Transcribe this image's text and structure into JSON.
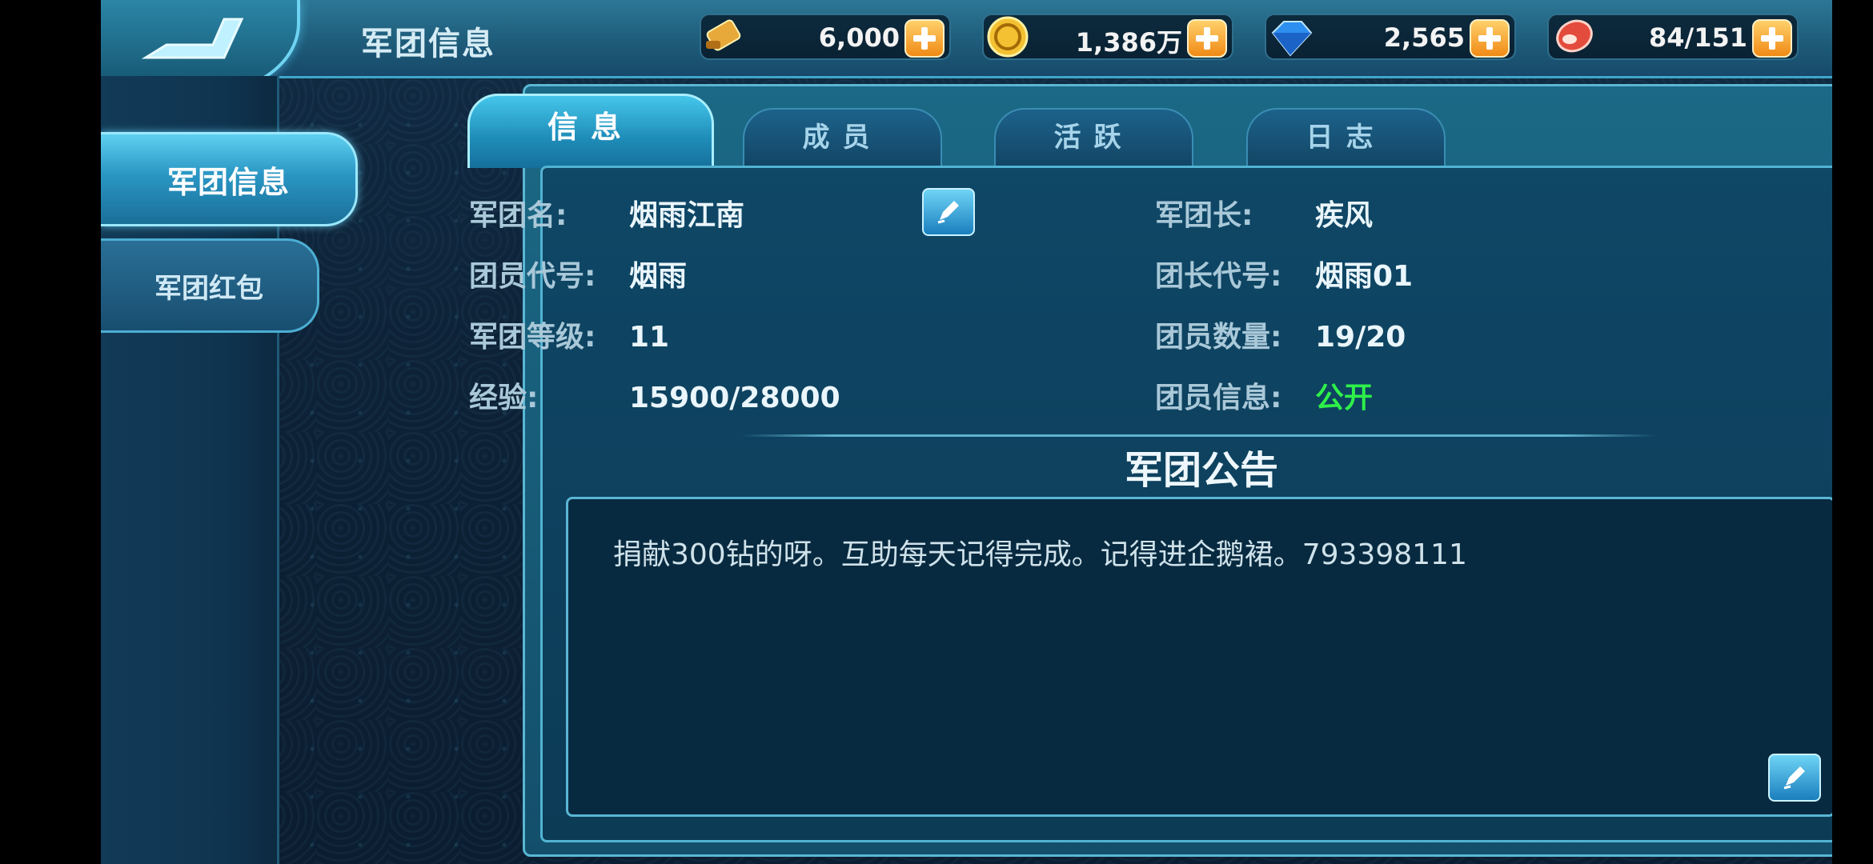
{
  "header": {
    "title": "军团信息",
    "resources": [
      {
        "icon": "gold-scroll-icon",
        "value": "6,000"
      },
      {
        "icon": "gold-coin-icon",
        "value": "1,386万"
      },
      {
        "icon": "diamond-icon",
        "value": "2,565"
      },
      {
        "icon": "meat-stamina-icon",
        "value": "84/151"
      }
    ]
  },
  "sidebar": {
    "items": [
      {
        "label": "军团信息",
        "active": true
      },
      {
        "label": "军团红包",
        "active": false
      }
    ]
  },
  "tabs": [
    {
      "label": "信息",
      "active": true
    },
    {
      "label": "成员",
      "active": false
    },
    {
      "label": "活跃",
      "active": false
    },
    {
      "label": "日志",
      "active": false
    }
  ],
  "info": {
    "left": [
      {
        "label": "军团名:",
        "value": "烟雨江南"
      },
      {
        "label": "团员代号:",
        "value": "烟雨"
      },
      {
        "label": "军团等级:",
        "value": "11"
      },
      {
        "label": "经验:",
        "value": "15900/28000"
      }
    ],
    "right": [
      {
        "label": "军团长:",
        "value": "疾风"
      },
      {
        "label": "团长代号:",
        "value": "烟雨01"
      },
      {
        "label": "团员数量:",
        "value": "19/20"
      },
      {
        "label": "团员信息:",
        "value": "公开"
      }
    ]
  },
  "notice": {
    "title": "军团公告",
    "text": "捐献300钻的呀。互助每天记得完成。记得进企鹅裙。793398111"
  },
  "colors": {
    "accent": "#45c6ea",
    "public_status": "#2ef04a",
    "plus_button": "#f08a16"
  }
}
